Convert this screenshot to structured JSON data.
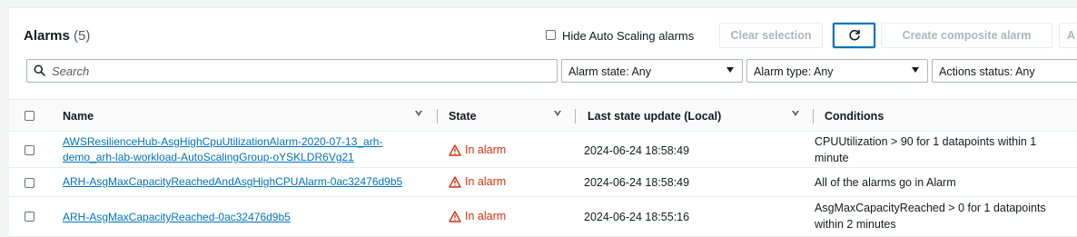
{
  "header": {
    "title": "Alarms",
    "count": "(5)"
  },
  "hide_autoscaling_label": "Hide Auto Scaling alarms",
  "buttons": {
    "clear_selection": "Clear selection",
    "create_composite": "Create composite alarm",
    "cut_off": "A"
  },
  "search": {
    "placeholder": "Search"
  },
  "filters": {
    "alarm_state": "Alarm state: Any",
    "alarm_type": "Alarm type: Any",
    "actions_status": "Actions status: Any"
  },
  "columns": {
    "name": "Name",
    "state": "State",
    "last_update": "Last state update (Local)",
    "conditions": "Conditions"
  },
  "rows": [
    {
      "name_line1": "AWSResilienceHub-AsgHighCpuUtilizationAlarm-2020-07-13_arh-",
      "name_line2": "demo_arh-lab-workload-AutoScalingGroup-oYSKLDR6Vg21",
      "state": "In alarm",
      "updated": "2024-06-24 18:58:49",
      "cond_line1": "CPUUtilization > 90 for 1 datapoints within 1",
      "cond_line2": "minute"
    },
    {
      "name_line1": "ARH-AsgMaxCapacityReachedAndAsgHighCPUAlarm-0ac32476d9b5",
      "state": "In alarm",
      "updated": "2024-06-24 18:58:49",
      "cond_line1": "All of the alarms go in Alarm"
    },
    {
      "name_line1": "ARH-AsgMaxCapacityReached-0ac32476d9b5",
      "state": "In alarm",
      "updated": "2024-06-24 18:55:16",
      "cond_line1": "AsgMaxCapacityReached > 0 for 1 datapoints",
      "cond_line2": "within 2 minutes"
    }
  ],
  "colors": {
    "link": "#0073bb",
    "alarm_red": "#d13212",
    "refresh_focus": "#0073bb"
  }
}
